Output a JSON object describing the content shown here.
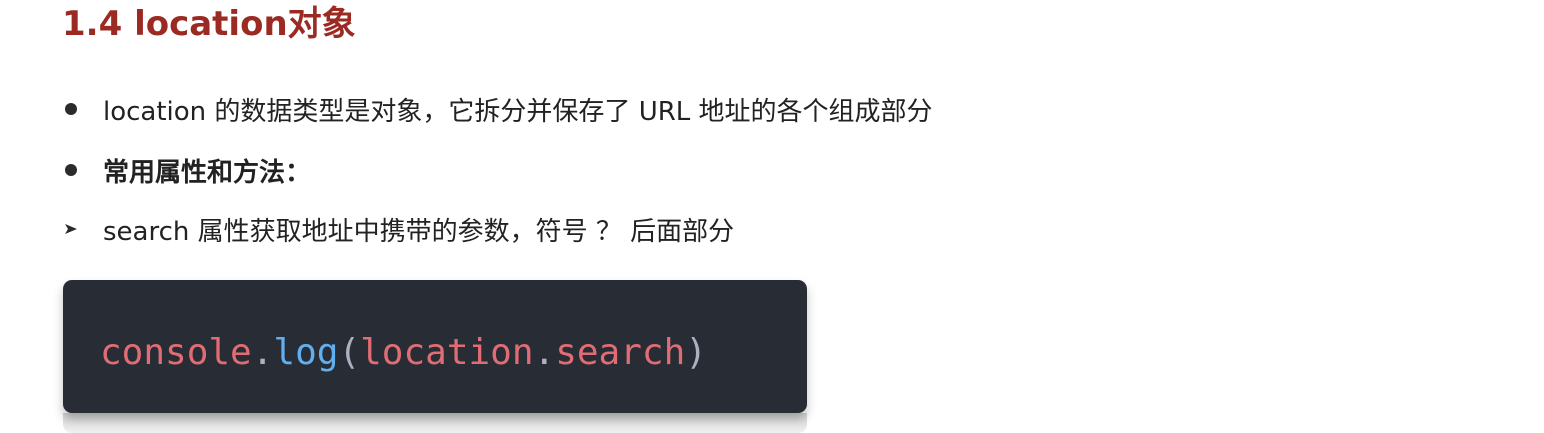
{
  "heading": "1.4 location对象",
  "bullets": [
    {
      "type": "dot",
      "text": "location 的数据类型是对象，它拆分并保存了 URL 地址的各个组成部分",
      "bold": false
    },
    {
      "type": "dot",
      "text": "常用属性和方法：",
      "bold": true
    },
    {
      "type": "arrow",
      "text": "search 属性获取地址中携带的参数，符号 ？ 后面部分",
      "bold": false
    }
  ],
  "code": {
    "tokens": {
      "t1": "console",
      "t2": ".",
      "t3": "log",
      "t4": "(",
      "t5": "location",
      "t6": ".",
      "t7": "search",
      "t8": ")"
    },
    "colors": {
      "background": "#282c34",
      "object": "#e06c75",
      "function": "#61afef",
      "punctuation": "#abb2bf"
    }
  },
  "colors": {
    "heading": "#9b2a22",
    "text": "#222222"
  }
}
